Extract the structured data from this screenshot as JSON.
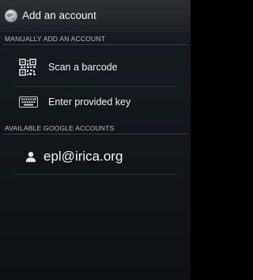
{
  "app_bar": {
    "title": "Add an account",
    "icon": "globe-icon"
  },
  "sections": {
    "manual": {
      "header": "MANUALLY ADD AN ACCOUNT",
      "items": [
        {
          "label": "Scan a barcode",
          "icon": "qr-code-icon"
        },
        {
          "label": "Enter provided key",
          "icon": "keyboard-icon"
        }
      ]
    },
    "google": {
      "header": "AVAILABLE GOOGLE ACCOUNTS",
      "accounts": [
        {
          "label": "epl@irica.org",
          "icon": "person-icon"
        }
      ]
    }
  },
  "colors": {
    "background": "#161b21",
    "action_bar": "#2c3034",
    "text_primary": "#eef0f2",
    "section_header": "#b8bcc0",
    "divider": "#3a4046"
  }
}
